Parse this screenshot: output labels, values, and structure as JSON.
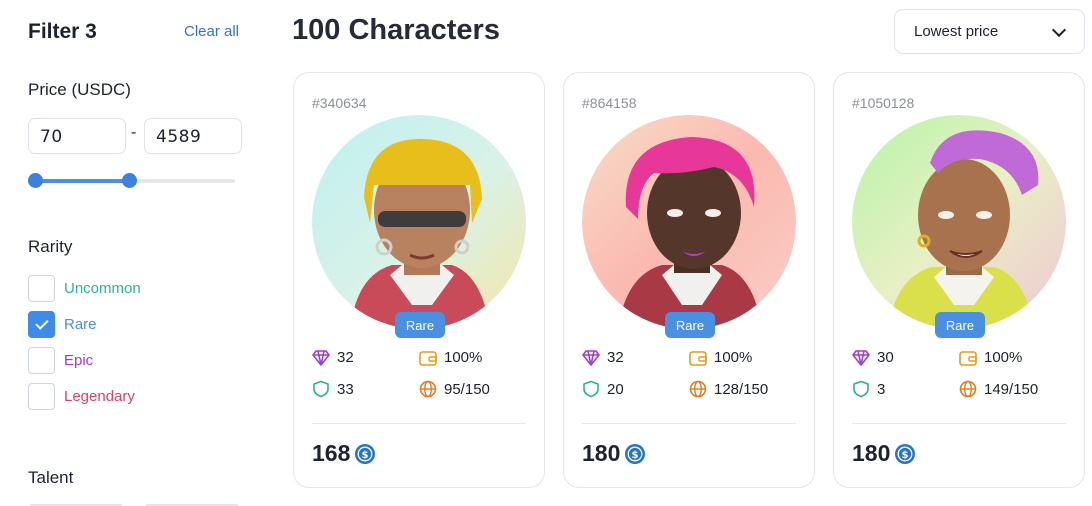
{
  "sidebar": {
    "filter_title": "Filter 3",
    "clear_all": "Clear all",
    "price_label": "Price (USDC)",
    "price_min": "70",
    "price_max": "4589",
    "price_range_selected": {
      "min_fraction": 0.0,
      "max_fraction": 0.45
    },
    "rarity_label": "Rarity",
    "rarities": [
      {
        "label": "Uncommon",
        "checked": false,
        "color": "#2bb58a"
      },
      {
        "label": "Rare",
        "checked": true,
        "color": "#4a90e2"
      },
      {
        "label": "Epic",
        "checked": false,
        "color": "#a23ad1"
      },
      {
        "label": "Legendary",
        "checked": false,
        "color": "#d64562"
      }
    ],
    "talent_label": "Talent"
  },
  "main": {
    "title": "100 Characters",
    "sort_selected": "Lowest price",
    "cards": [
      {
        "id": "#340634",
        "rarity": "Rare",
        "stats": {
          "gems": "32",
          "wallet": "100%",
          "shield": "33",
          "globe": "95/150"
        },
        "price": "168"
      },
      {
        "id": "#864158",
        "rarity": "Rare",
        "stats": {
          "gems": "32",
          "wallet": "100%",
          "shield": "20",
          "globe": "128/150"
        },
        "price": "180"
      },
      {
        "id": "#1050128",
        "rarity": "Rare",
        "stats": {
          "gems": "30",
          "wallet": "100%",
          "shield": "3",
          "globe": "149/150"
        },
        "price": "180"
      }
    ]
  },
  "icons": {
    "gem": "diamond-icon",
    "wallet": "wallet-icon",
    "shield": "shield-icon",
    "globe": "globe-icon",
    "currency": "usdc-coin-icon",
    "sort_chevron": "chevron-down-icon"
  },
  "colors": {
    "accent": "#3d8bea",
    "gem": "#9b3fd6",
    "wallet": "#e39b20",
    "shield": "#2bb58a",
    "globe": "#e37b1e",
    "usdc": "#2775ca"
  }
}
